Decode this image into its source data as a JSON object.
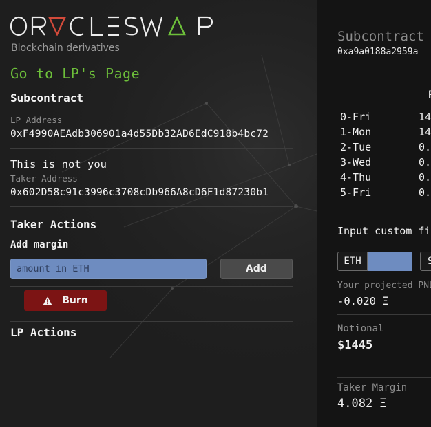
{
  "brand": {
    "logo_text": "ORACLESWAP",
    "tagline": "Blockchain derivatives",
    "accent_red": "#d24a3a",
    "accent_green": "#6dbf3a"
  },
  "left": {
    "lp_link": "Go to LP's Page",
    "subcontract_heading": "Subcontract",
    "lp_address_label": "LP Address",
    "lp_address": "0xF4990AEAdb306901a4d55Db32AD6EdC918b4bc72",
    "not_you_text": "This is not you",
    "taker_address_label": "Taker Address",
    "taker_address": "0x602D58c91c3996c3708cDb966A8cD6F1d87230b1",
    "taker_actions_heading": "Taker Actions",
    "add_margin_label": "Add margin",
    "amount_placeholder": "amount in ETH",
    "add_button": "Add",
    "burn_button": "Burn",
    "lp_actions_heading": "LP Actions"
  },
  "right": {
    "title": "Subcontract",
    "address": "0xa9a0188a2959a",
    "column_head": "P",
    "schedule": [
      {
        "day": "0-Fri",
        "value": "14"
      },
      {
        "day": "1-Mon",
        "value": "14"
      },
      {
        "day": "2-Tue",
        "value": "0."
      },
      {
        "day": "3-Wed",
        "value": "0."
      },
      {
        "day": "4-Thu",
        "value": "0."
      },
      {
        "day": "5-Fri",
        "value": "0."
      }
    ],
    "custom_label": "Input custom fi",
    "eth_unit": "ETH",
    "s_button": "S",
    "pnl_label": "Your projected PNL",
    "pnl_value": "-0.020 Ξ",
    "notional_label": "Notional",
    "notional_value": "$1445",
    "taker_margin_label": "Taker Margin",
    "taker_margin_value": "4.082 Ξ"
  }
}
